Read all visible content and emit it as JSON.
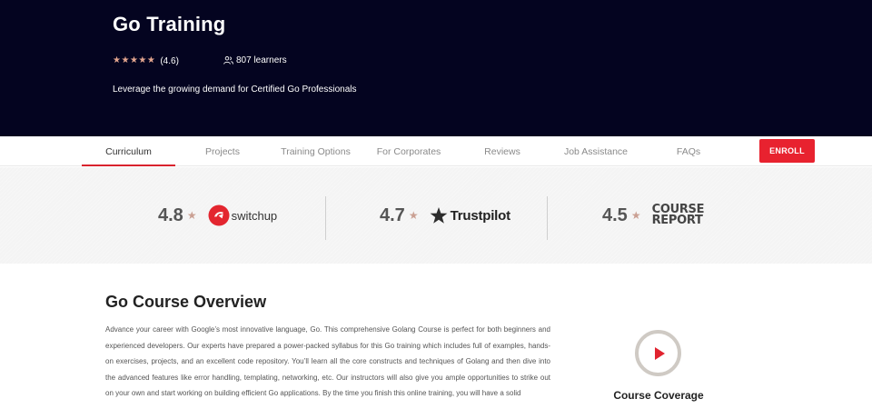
{
  "hero": {
    "title": "Go Training",
    "rating_text": "(4.6)",
    "learners_text": "807 learners",
    "tagline": "Leverage the growing demand for Certified Go Professionals",
    "stars": [
      "★",
      "★",
      "★",
      "★",
      "★"
    ]
  },
  "nav": {
    "tabs": [
      {
        "label": "Curriculum",
        "active": true
      },
      {
        "label": "Projects",
        "active": false
      },
      {
        "label": "Training Options",
        "active": false
      },
      {
        "label": "For Corporates",
        "active": false
      },
      {
        "label": "Reviews",
        "active": false
      },
      {
        "label": "Job Assistance",
        "active": false
      },
      {
        "label": "FAQs",
        "active": false
      }
    ],
    "enroll_label": "ENROLL"
  },
  "ratings": [
    {
      "score": "4.8",
      "star": "★",
      "brand": "switchup"
    },
    {
      "score": "4.7",
      "star": "★",
      "brand": "Trustpilot"
    },
    {
      "score": "4.5",
      "star": "★",
      "brand_lines": [
        "COURSE",
        "REPORT"
      ]
    }
  ],
  "overview": {
    "title": "Go Course Overview",
    "text": "Advance your career with Google’s most innovative language, Go. This comprehensive Golang Course is perfect for both beginners and experienced developers. Our experts have prepared a power-packed syllabus for this Go training which includes full of examples, hands-on exercises, projects, and an excellent code repository.  You’ll learn all the core constructs and techniques of Golang and then dive into the advanced features like error handling, templating, networking, etc. Our instructors will also give you ample opportunities to strike out on your own and start working on building efficient Go applications. By the time you finish this online training, you will have a solid"
  },
  "coverage": {
    "label": "Course Coverage",
    "icon": "play-icon"
  },
  "colors": {
    "hero_bg": "#040420",
    "accent_red": "#e8222f",
    "star_color": "#e4a68f",
    "ratings_bg": "#f4f4f4"
  }
}
